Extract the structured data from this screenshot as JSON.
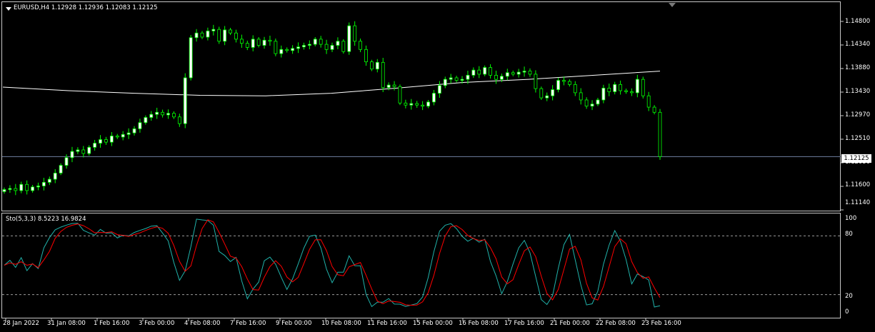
{
  "header": {
    "symbol_line": "EURUSD,H4  1.12928 1.12936 1.12083 1.12125"
  },
  "oscillator": {
    "label": "Sto(5,3,3) 8.5223 16.9824",
    "levels": [
      "100",
      "80",
      "20",
      "0"
    ]
  },
  "price_axis": {
    "labels": [
      "1.14800",
      "1.14340",
      "1.13880",
      "1.13430",
      "1.12970",
      "1.12510",
      "1.12050",
      "1.11600",
      "1.11140"
    ],
    "current": "1.12125"
  },
  "time_axis": {
    "labels": [
      "28 Jan 2022",
      "31 Jan 08:00",
      "1 Feb 16:00",
      "3 Feb 00:00",
      "4 Feb 08:00",
      "7 Feb 16:00",
      "9 Feb 00:00",
      "10 Feb 08:00",
      "11 Feb 16:00",
      "15 Feb 00:00",
      "16 Feb 08:00",
      "17 Feb 16:00",
      "21 Feb 00:00",
      "22 Feb 08:00",
      "23 Feb 16:00"
    ]
  },
  "colors": {
    "background": "#000000",
    "bull_candle": "#ffffff",
    "bear_candle": "#000000",
    "wick": "#00ff00",
    "moving_average": "#ffffff",
    "stoch_main": "#20b2aa",
    "stoch_signal": "#ff0000",
    "price_line": "#7080a0"
  },
  "chart_data": {
    "type": "candlestick",
    "symbol": "EURUSD",
    "timeframe": "H4",
    "ylim": [
      1.1114,
      1.1505
    ],
    "closes": [
      1.1148,
      1.115,
      1.1146,
      1.1158,
      1.1146,
      1.1153,
      1.1155,
      1.1162,
      1.1168,
      1.118,
      1.1195,
      1.121,
      1.1222,
      1.1225,
      1.1218,
      1.123,
      1.1238,
      1.1245,
      1.124,
      1.1252,
      1.125,
      1.1255,
      1.1258,
      1.1266,
      1.1278,
      1.1288,
      1.1294,
      1.1298,
      1.1293,
      1.1296,
      1.1289,
      1.1276,
      1.1365,
      1.1443,
      1.1452,
      1.1444,
      1.1456,
      1.1459,
      1.1436,
      1.1458,
      1.1452,
      1.144,
      1.1432,
      1.1424,
      1.144,
      1.1428,
      1.1438,
      1.1436,
      1.1412,
      1.142,
      1.1418,
      1.1422,
      1.1425,
      1.1428,
      1.143,
      1.144,
      1.143,
      1.142,
      1.1428,
      1.1436,
      1.1416,
      1.1466,
      1.1436,
      1.142,
      1.1396,
      1.1382,
      1.1395,
      1.1346,
      1.1351,
      1.1348,
      1.1316,
      1.1312,
      1.1315,
      1.1312,
      1.131,
      1.1318,
      1.1335,
      1.135,
      1.1362,
      1.1365,
      1.136,
      1.1362,
      1.137,
      1.138,
      1.1372,
      1.1385,
      1.137,
      1.1362,
      1.1368,
      1.1375,
      1.1372,
      1.1376,
      1.1378,
      1.1372,
      1.1344,
      1.1326,
      1.133,
      1.1342,
      1.136,
      1.1358,
      1.1352,
      1.1336,
      1.1322,
      1.131,
      1.1314,
      1.1322,
      1.1345,
      1.1338,
      1.1352,
      1.134,
      1.1338,
      1.1336,
      1.1362,
      1.133,
      1.1308,
      1.1298,
      1.1212
    ],
    "moving_average": [
      1.1347,
      1.134,
      1.1335,
      1.1331,
      1.133,
      1.1335,
      1.1345,
      1.1356,
      1.1362,
      1.137,
      1.1378
    ],
    "stochastic": {
      "label": "Sto(5,3,3)",
      "main_last": 8.5223,
      "signal_last": 16.9824,
      "levels": [
        80,
        20
      ],
      "ylim": [
        0,
        100
      ]
    }
  }
}
